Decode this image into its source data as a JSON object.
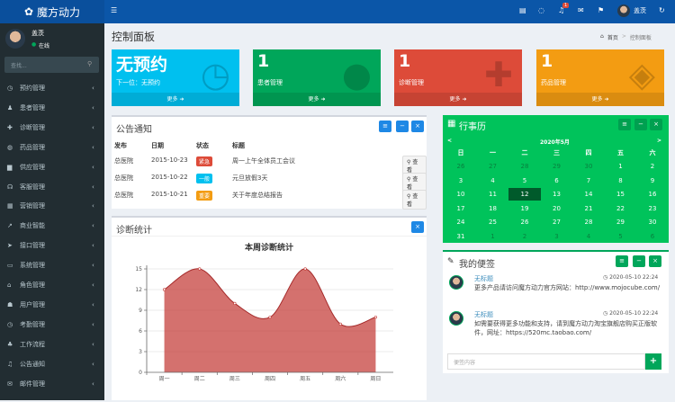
{
  "app": {
    "title": "魔方动力",
    "user": "盖茨",
    "status": "在线",
    "notif_count": "1"
  },
  "search": {
    "placeholder": "查找..."
  },
  "sidebar": {
    "items": [
      {
        "label": "预约管理",
        "icon": "◷"
      },
      {
        "label": "患者管理",
        "icon": "♟"
      },
      {
        "label": "诊断管理",
        "icon": "✚"
      },
      {
        "label": "药品管理",
        "icon": "◍"
      },
      {
        "label": "供应管理",
        "icon": "▆"
      },
      {
        "label": "客服管理",
        "icon": "☊"
      },
      {
        "label": "营销管理",
        "icon": "▦"
      },
      {
        "label": "商业智能",
        "icon": "↗"
      },
      {
        "label": "接口管理",
        "icon": "➤"
      },
      {
        "label": "系统管理",
        "icon": "▭"
      },
      {
        "label": "角色管理",
        "icon": "⌂"
      },
      {
        "label": "用户管理",
        "icon": "☗"
      },
      {
        "label": "考勤管理",
        "icon": "◷"
      },
      {
        "label": "工作流程",
        "icon": "♣"
      },
      {
        "label": "公告通知",
        "icon": "♫"
      },
      {
        "label": "邮件管理",
        "icon": "✉"
      }
    ]
  },
  "page": {
    "title": "控制面板",
    "breadcrumb_home": "首页",
    "breadcrumb_current": "控制面板"
  },
  "boxes": [
    {
      "num": "无预约",
      "label": "下一位：无预约",
      "more": "更多 ➜",
      "color": "#00c0ef",
      "icon": "◷"
    },
    {
      "num": "1",
      "label": "患者管理",
      "more": "更多 ➜",
      "color": "#00a65a",
      "icon": "●"
    },
    {
      "num": "1",
      "label": "诊断管理",
      "more": "更多 ➜",
      "color": "#dd4b39",
      "icon": "✚"
    },
    {
      "num": "1",
      "label": "药品管理",
      "more": "更多 ➜",
      "color": "#f39c12",
      "icon": "◈"
    }
  ],
  "notice": {
    "title": "公告通知",
    "headers": [
      "发布",
      "日期",
      "状态",
      "标题"
    ],
    "view_label": "查看",
    "rows": [
      {
        "pub": "总医院",
        "date": "2015-10-23",
        "status": "紧急",
        "status_color": "#dd4b39",
        "title": "周一上午全体员工会议"
      },
      {
        "pub": "总医院",
        "date": "2015-10-22",
        "status": "一般",
        "status_color": "#00c0ef",
        "title": "元旦放假3天"
      },
      {
        "pub": "总医院",
        "date": "2015-10-21",
        "status": "重要",
        "status_color": "#f39c12",
        "title": "关于年度总结报告"
      }
    ]
  },
  "calendar": {
    "title": "行事历",
    "month": "2020年5月",
    "prev": "<",
    "next": ">",
    "weekdays": [
      "日",
      "一",
      "二",
      "三",
      "四",
      "五",
      "六"
    ],
    "weeks": [
      [
        "26",
        "27",
        "28",
        "29",
        "30",
        "1",
        "2"
      ],
      [
        "3",
        "4",
        "5",
        "6",
        "7",
        "8",
        "9"
      ],
      [
        "10",
        "11",
        "12",
        "13",
        "14",
        "15",
        "16"
      ],
      [
        "17",
        "18",
        "19",
        "20",
        "21",
        "22",
        "23"
      ],
      [
        "24",
        "25",
        "26",
        "27",
        "28",
        "29",
        "30"
      ],
      [
        "31",
        "1",
        "2",
        "3",
        "4",
        "5",
        "6"
      ]
    ],
    "today": "12"
  },
  "stats": {
    "title": "诊断统计"
  },
  "chart_data": {
    "type": "area",
    "title": "本周诊断统计",
    "categories": [
      "周一",
      "周二",
      "周三",
      "周四",
      "周五",
      "周六",
      "周日"
    ],
    "values": [
      12,
      15,
      10,
      8,
      15,
      7,
      8
    ],
    "ylim": [
      0,
      15
    ],
    "yticks": [
      0,
      3,
      6,
      9,
      12,
      15
    ],
    "color": "#c23531"
  },
  "notes": {
    "title": "我的便签",
    "placeholder": "便签内容",
    "items": [
      {
        "title": "无标题",
        "time": "◷ 2020-05-10 22:24",
        "text": "更多产品请访问魔方动力官方网站：http://www.mojocube.com/"
      },
      {
        "title": "无标题",
        "time": "◷ 2020-05-10 22:24",
        "text": "如需要获得更多功能和支持，请到魔方动力淘宝旗舰店购买正版软件，网址：https://520mc.taobao.com/"
      }
    ]
  }
}
